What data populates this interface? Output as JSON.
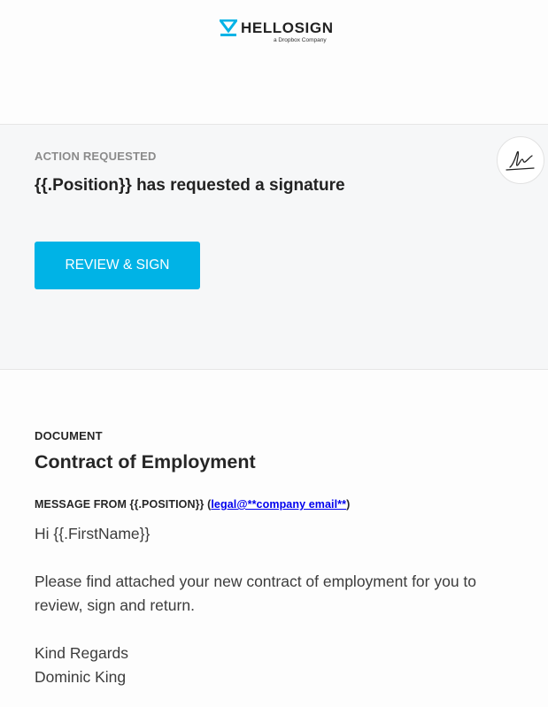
{
  "brand": {
    "name": "HELLOSIGN",
    "tagline": "a Dropbox Company",
    "accent_color": "#00b3e6"
  },
  "action": {
    "label": "ACTION REQUESTED",
    "title": "{{.Position}} has requested a signature",
    "button_label": "REVIEW & SIGN",
    "badge_icon": "signature-icon"
  },
  "document": {
    "label": "DOCUMENT",
    "title": "Contract of Employment",
    "message_from_prefix": "MESSAGE FROM {{.POSITION}} (",
    "message_from_email": "legal@**company email**",
    "message_from_suffix": ")",
    "greeting": "Hi {{.FirstName}}",
    "body_line_1": "Please find attached your new contract of employment for you to",
    "body_line_2": "review, sign and return.",
    "closing": "Kind Regards",
    "signer": "Dominic King"
  }
}
